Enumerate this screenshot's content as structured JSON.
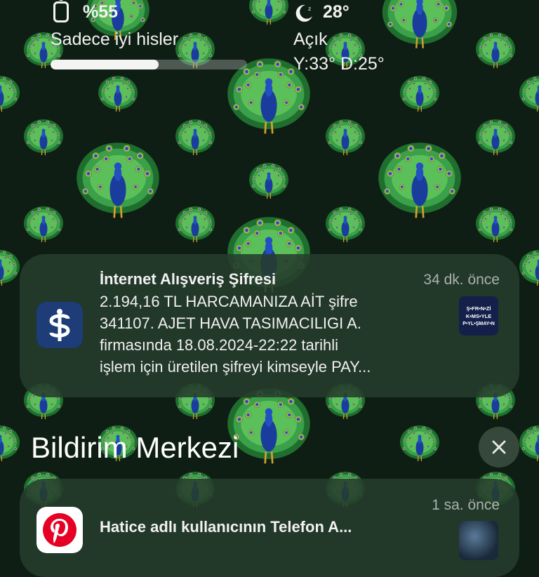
{
  "battery": {
    "percent_label": "%55",
    "icon": "battery-icon"
  },
  "mood": {
    "label": "Sadece iyi hisler",
    "progress": 0.55
  },
  "weather": {
    "icon": "moon-icon",
    "temperature": "28°",
    "condition": "Açık",
    "range": "Y:33° D:25°"
  },
  "notification_1": {
    "app_icon": "isbank-logo",
    "title": "İnternet Alışveriş Şifresi",
    "time": "34 dk. önce",
    "lines": [
      "2.194,16 TL HARCAMANIZA AİT şifre",
      "341107. AJET HAVA TASIMACILIGI A.",
      "firmasında 18.08.2024-22:22 tarihli",
      "işlem için üretilen şifreyi kimseyle PAY..."
    ],
    "thumbnail": {
      "lines": [
        "Ş•FR•N•Zİ",
        "K•MS•YLE",
        "P•YL•ŞMAY•N"
      ]
    }
  },
  "notification_center": {
    "title": "Bildirim Merkezi",
    "close_icon": "close-icon"
  },
  "notification_2": {
    "app_icon": "pinterest-logo",
    "time": "1 sa. önce",
    "title": "Hatice adlı kullanıcının Telefon A..."
  },
  "colors": {
    "background": "#0f1e14",
    "card": "#263c2c",
    "isbank_blue": "#1d3c78",
    "pinterest_red": "#e60023"
  }
}
